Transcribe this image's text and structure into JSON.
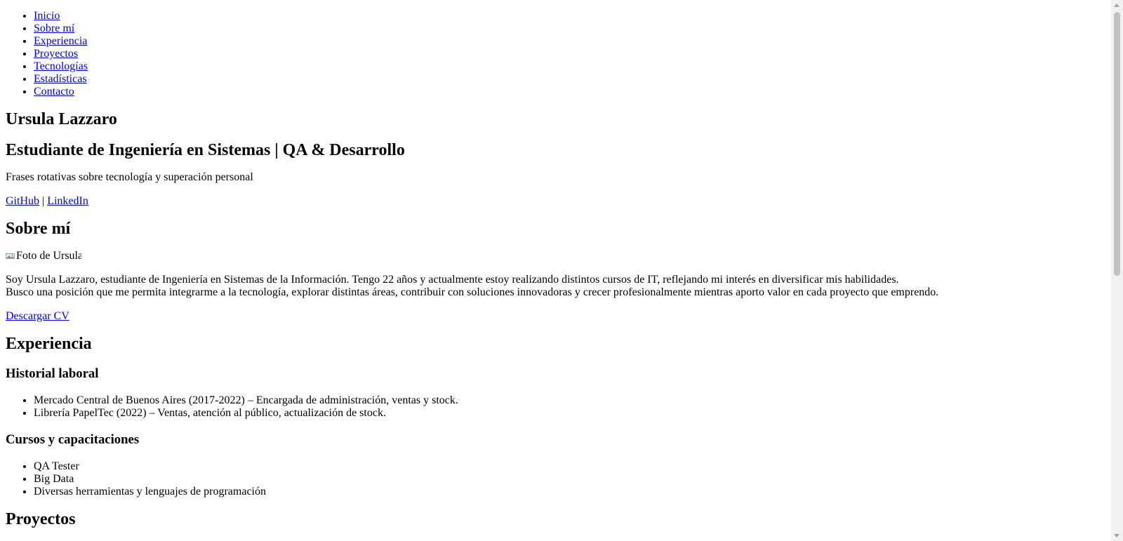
{
  "nav": {
    "items": [
      {
        "label": "Inicio"
      },
      {
        "label": "Sobre mí"
      },
      {
        "label": "Experiencia"
      },
      {
        "label": "Proyectos"
      },
      {
        "label": "Tecnologías"
      },
      {
        "label": "Estadísticas"
      },
      {
        "label": "Contacto"
      }
    ]
  },
  "hero": {
    "name": "Ursula Lazzaro",
    "subtitle": "Estudiante de Ingeniería en Sistemas | QA & Desarrollo",
    "tagline": "Frases rotativas sobre tecnología y superación personal",
    "github_label": "GitHub",
    "separator": " | ",
    "linkedin_label": "LinkedIn"
  },
  "about": {
    "title": "Sobre mí",
    "photo_alt": "Foto de Ursula",
    "line1": "Soy Ursula Lazzaro, estudiante de Ingeniería en Sistemas de la Información. Tengo 22 años y actualmente estoy realizando distintos cursos de IT, reflejando mi interés en diversificar mis habilidades.",
    "line2": "Busco una posición que me permita integrarme a la tecnología, explorar distintas áreas, contribuir con soluciones innovadoras y crecer profesionalmente mientras aporto valor en cada proyecto que emprendo.",
    "cv_label": "Descargar CV"
  },
  "experience": {
    "title": "Experiencia",
    "work_title": "Historial laboral",
    "work_items": [
      "Mercado Central de Buenos Aires (2017-2022) – Encargada de administración, ventas y stock.",
      "Librería PapelTec (2022) – Ventas, atención al público, actualización de stock."
    ],
    "courses_title": "Cursos y capacitaciones",
    "courses_items": [
      "QA Tester",
      "Big Data",
      "Diversas herramientas y lenguajes de programación"
    ]
  },
  "projects": {
    "title": "Proyectos"
  },
  "colors": {
    "link": "#0000ee",
    "text": "#000000",
    "background": "#ffffff",
    "scrollbar_track": "#f1f1f1",
    "scrollbar_thumb": "#c1c1c1"
  }
}
